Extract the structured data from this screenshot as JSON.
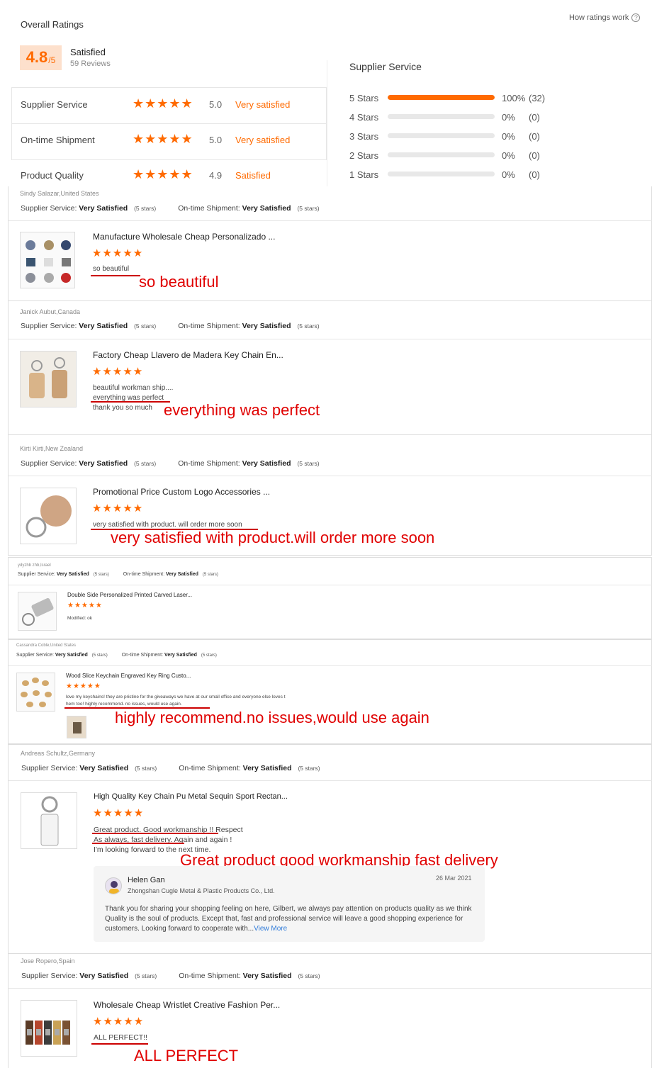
{
  "summary": {
    "title": "Overall Ratings",
    "how_ratings_work": "How ratings work",
    "score": "4.8",
    "score_suffix": "/5",
    "score_label": "Satisfied",
    "reviews_count": "59 Reviews",
    "metrics": [
      {
        "name": "Supplier Service",
        "score": "5.0",
        "text": "Very satisfied",
        "stars": "★★★★★"
      },
      {
        "name": "On-time Shipment",
        "score": "5.0",
        "text": "Very satisfied",
        "stars": "★★★★★"
      },
      {
        "name": "Product Quality",
        "score": "4.9",
        "text": "Satisfied",
        "stars": "★★★★★"
      }
    ],
    "distribution": {
      "title": "Supplier Service",
      "rows": [
        {
          "label": "5 Stars",
          "pct": "100%",
          "count": "(32)",
          "fill": 1.0
        },
        {
          "label": "4 Stars",
          "pct": "0%",
          "count": "(0)",
          "fill": 0
        },
        {
          "label": "3 Stars",
          "pct": "0%",
          "count": "(0)",
          "fill": 0
        },
        {
          "label": "2 Stars",
          "pct": "0%",
          "count": "(0)",
          "fill": 0
        },
        {
          "label": "1 Stars",
          "pct": "0%",
          "count": "(0)",
          "fill": 0
        }
      ]
    }
  },
  "meta_labels": {
    "supplier_service": "Supplier Service:",
    "on_time": "On-time Shipment:",
    "very_satisfied": "Very Satisfied",
    "five_stars": "(5 stars)"
  },
  "reviews": [
    {
      "name": "Sindy Salazar,United States",
      "product": "Manufacture Wholesale Cheap Personalizado ...",
      "stars": "★★★★★",
      "lines": [
        "so beautiful"
      ],
      "annotation": "so beautiful"
    },
    {
      "name": "Janick Aubut,Canada",
      "product": "Factory Cheap Llavero de Madera Key Chain En...",
      "stars": "★★★★★",
      "lines": [
        "beautiful workman ship....",
        "everything was perfect",
        "thank you so much"
      ],
      "annotation": "everything was perfect"
    },
    {
      "name": "Kirti Kirti,New Zealand",
      "product": "Promotional Price Custom Logo Accessories ...",
      "stars": "★★★★★",
      "lines": [
        "very satisfied with product. will order more soon"
      ],
      "annotation": "very satisfied with product.will order more soon"
    },
    {
      "name": "ydyzhb zhb,Israel",
      "product": "Double Side Personalized Printed Carved Laser...",
      "stars": "★★★★★",
      "lines": [
        "Modified: ok"
      ],
      "annotation": ""
    },
    {
      "name": "Cassandra Coble,United States",
      "product": "Wood Slice Keychain Engraved Key Ring Custo...",
      "stars": "★★★★★",
      "lines": [
        "love my keychains! they are pristine for the giveaways we have at our small office and everyone else loves t",
        "hem too! highly recommend. no issues, would use again."
      ],
      "annotation": "highly recommend.no issues,would use again"
    },
    {
      "name": "Andreas Schultz,Germany",
      "product": "High Quality Key Chain Pu Metal Sequin Sport Rectan...",
      "stars": "★★★★★",
      "lines": [
        "Great product. Good workmanship !! Respect",
        "As always, fast delivery. Again and again !",
        "I'm looking forward to the next time."
      ],
      "annotation": "Great product good workmanship fast delivery",
      "reply": {
        "name": "Helen Gan",
        "company": "Zhongshan Cugle Metal & Plastic Products Co., Ltd.",
        "date": "26 Mar 2021",
        "text": "Thank you for sharing your shopping feeling on here, Gilbert, we always pay attention on products quality as we think Quality is the soul of products. Except that, fast and professional service will leave a good shopping experience for customers. Looking forward to cooperate with...",
        "view_more": "View More"
      }
    },
    {
      "name": "Jose Ropero,Spain",
      "product": "Wholesale Cheap Wristlet Creative Fashion Per...",
      "stars": "★★★★★",
      "lines": [
        "ALL PERFECT!!"
      ],
      "annotation": "ALL PERFECT"
    }
  ],
  "colors": {
    "accent": "#ff6a00",
    "annotation": "#e00000"
  }
}
